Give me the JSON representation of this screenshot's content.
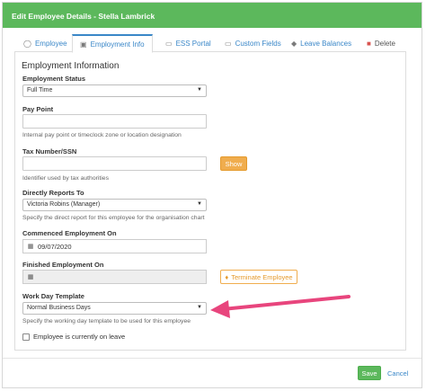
{
  "header": {
    "title": "Edit Employee Details - Stella Lambrick"
  },
  "tabs": [
    {
      "label": "Employee",
      "icon": "user-icon"
    },
    {
      "label": "Employment Info",
      "icon": "id-card-icon",
      "active": true
    },
    {
      "label": "ESS Portal",
      "icon": "chat-icon"
    },
    {
      "label": "Custom Fields",
      "icon": "folder-icon"
    },
    {
      "label": "Leave Balances",
      "icon": "graduation-cap-icon"
    },
    {
      "label": "Delete",
      "icon": "trash-icon"
    }
  ],
  "section": {
    "title": "Employment Information"
  },
  "fields": {
    "employment_status": {
      "label": "Employment Status",
      "value": "Full Time"
    },
    "pay_point": {
      "label": "Pay Point",
      "value": "",
      "help": "Internal pay point or timeclock zone or location designation"
    },
    "tax_number": {
      "label": "Tax Number/SSN",
      "value": "",
      "help": "Identifier used by tax authorities",
      "show_label": "Show"
    },
    "reports_to": {
      "label": "Directly Reports To",
      "value": "Victoria Robins (Manager)",
      "help": "Specify the direct report for this employee for the organisation chart"
    },
    "commenced": {
      "label": "Commenced Employment On",
      "value": "09/07/2020"
    },
    "finished": {
      "label": "Finished Employment On",
      "value": "",
      "terminate_label": "Terminate Employee"
    },
    "work_day_template": {
      "label": "Work Day Template",
      "value": "Normal Business Days",
      "help": "Specify the working day template to be used for this employee"
    },
    "on_leave": {
      "label": "Employee is currently on leave",
      "checked": false
    }
  },
  "footer": {
    "save_label": "Save",
    "cancel_label": "Cancel"
  },
  "colors": {
    "header": "#5cb85c",
    "accent": "#3a87c8",
    "warning": "#f0ad4e",
    "arrow": "#e8457d",
    "danger": "#d9534f"
  }
}
